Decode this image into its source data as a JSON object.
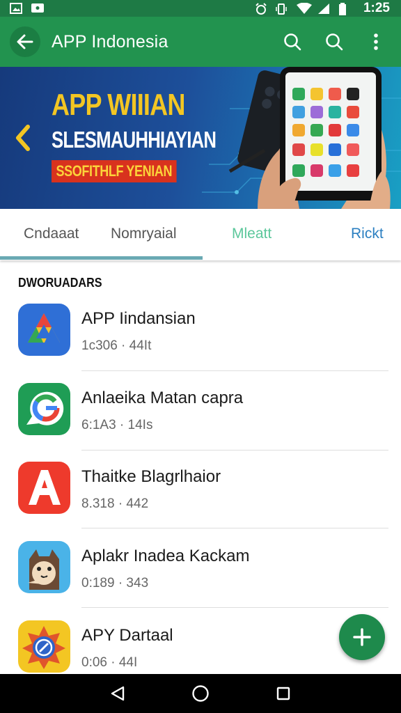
{
  "status_bar": {
    "time": "1:25",
    "icons": [
      "gallery-icon",
      "message-icon",
      "alarm-icon",
      "vibrate-icon",
      "wifi-icon",
      "signal-icon",
      "battery-icon"
    ]
  },
  "app_bar": {
    "title": "APP Indonesia",
    "background": "#22934f"
  },
  "banner": {
    "title_line1": "APP WIIIAN",
    "title_line2": "SLESMAUHHIAYIAN",
    "tag": "SSOFITHLF YENIAN"
  },
  "tabs": [
    {
      "label": "Cndaaat"
    },
    {
      "label": "Nomryaial"
    },
    {
      "label": "Mleatt"
    },
    {
      "label": "Rickt"
    }
  ],
  "section": {
    "title": "DWORUADARS"
  },
  "apps": [
    {
      "name": "APP Iindansian",
      "meta": "1c306 · 44It",
      "icon": "triangle-drive-icon"
    },
    {
      "name": "Anlaeika Matan capra",
      "meta": "6:1A3 · 14Is",
      "icon": "g-letter-icon"
    },
    {
      "name": "Thaitke Blagrlhaior",
      "meta": "8.318 · 442",
      "icon": "a-letter-icon"
    },
    {
      "name": "Aplakr Inadea Kackam",
      "meta": "0:189 · 343",
      "icon": "owl-mascot-icon"
    },
    {
      "name": "APY Dartaal",
      "meta": "0:06 · 44I",
      "icon": "compass-badge-icon"
    }
  ],
  "colors": {
    "accent": "#22934f",
    "fab": "#1e8a4c",
    "tab_indicator": "#6aa9b3",
    "banner_yellow": "#f3c623",
    "banner_red": "#d8321e"
  }
}
